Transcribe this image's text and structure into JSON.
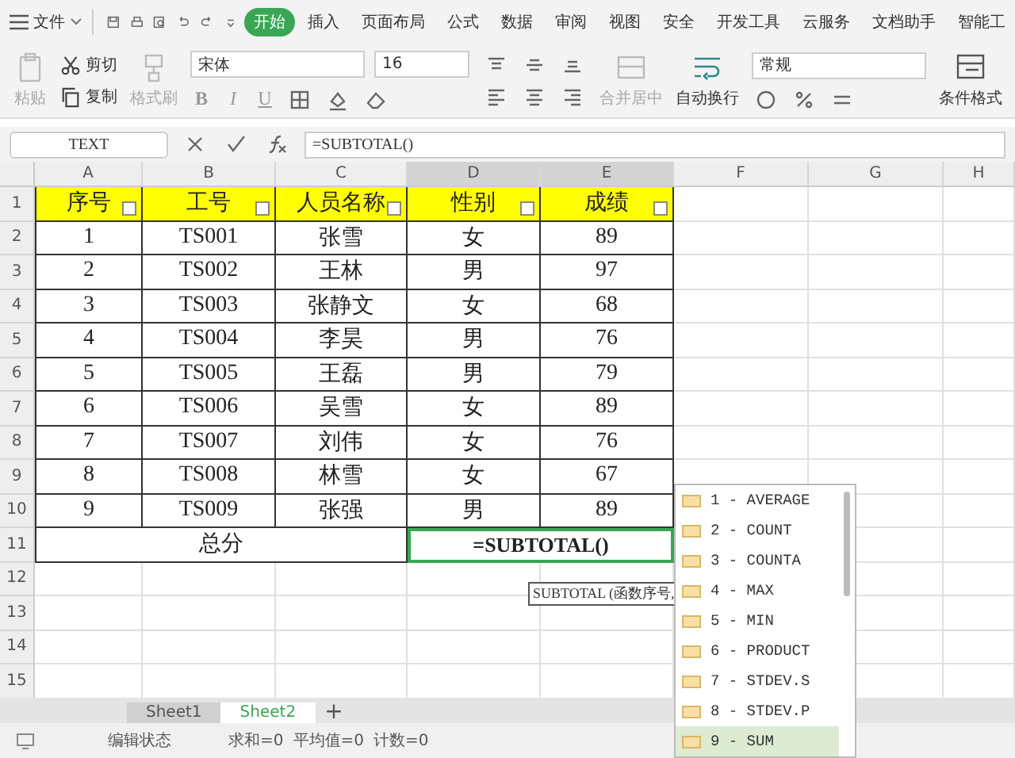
{
  "menu": {
    "file": "文件",
    "tabs": [
      {
        "label": "开始",
        "selected": true
      },
      {
        "label": "插入",
        "selected": false
      },
      {
        "label": "页面布局",
        "selected": false
      },
      {
        "label": "公式",
        "selected": false
      },
      {
        "label": "数据",
        "selected": false
      },
      {
        "label": "审阅",
        "selected": false
      },
      {
        "label": "视图",
        "selected": false
      },
      {
        "label": "安全",
        "selected": false
      },
      {
        "label": "开发工具",
        "selected": false
      },
      {
        "label": "云服务",
        "selected": false
      },
      {
        "label": "文档助手",
        "selected": false
      },
      {
        "label": "智能工",
        "selected": false
      }
    ]
  },
  "ribbon": {
    "paste": {
      "label": "粘贴",
      "disabled": true
    },
    "cut": "剪切",
    "copy": "复制",
    "format_painter": {
      "label": "格式刷",
      "disabled": true
    },
    "font": "宋体",
    "font_size": "16",
    "style_buttons": [
      "B",
      "I",
      "U"
    ],
    "merge": {
      "label": "合并居中",
      "disabled": true
    },
    "wrap": "自动换行",
    "number_format": "常规",
    "conditional_format": "条件格式"
  },
  "formula_bar": {
    "name_box": "TEXT",
    "formula": "=SUBTOTAL()"
  },
  "sheet": {
    "columns": [
      {
        "label": "A",
        "selected": false
      },
      {
        "label": "B",
        "selected": false
      },
      {
        "label": "C",
        "selected": false
      },
      {
        "label": "D",
        "selected": true
      },
      {
        "label": "E",
        "selected": true
      },
      {
        "label": "F",
        "selected": false
      },
      {
        "label": "G",
        "selected": false
      },
      {
        "label": "H",
        "selected": false
      }
    ],
    "row_headers": [
      "1",
      "2",
      "3",
      "4",
      "5",
      "6",
      "7",
      "8",
      "9",
      "10",
      "11",
      "12",
      "13",
      "14",
      "15"
    ],
    "header": [
      "序号",
      "工号",
      "人员名称",
      "性别",
      "成绩"
    ],
    "rows": [
      [
        "1",
        "TS001",
        "张雪",
        "女",
        "89"
      ],
      [
        "2",
        "TS002",
        "王林",
        "男",
        "97"
      ],
      [
        "3",
        "TS003",
        "张静文",
        "女",
        "68"
      ],
      [
        "4",
        "TS004",
        "李昊",
        "男",
        "76"
      ],
      [
        "5",
        "TS005",
        "王磊",
        "男",
        "79"
      ],
      [
        "6",
        "TS006",
        "吴雪",
        "女",
        "89"
      ],
      [
        "7",
        "TS007",
        "刘伟",
        "女",
        "76"
      ],
      [
        "8",
        "TS008",
        "林雪",
        "女",
        "67"
      ],
      [
        "9",
        "TS009",
        "张强",
        "男",
        "89"
      ]
    ],
    "total_row": {
      "label": "总分",
      "formula": "=SUBTOTAL()"
    }
  },
  "tooltip": "SUBTOTAL (函数序号,",
  "autocomplete": [
    {
      "label": "1 - AVERAGE",
      "selected": false
    },
    {
      "label": "2 - COUNT",
      "selected": false
    },
    {
      "label": "3 - COUNTA",
      "selected": false
    },
    {
      "label": "4 - MAX",
      "selected": false
    },
    {
      "label": "5 - MIN",
      "selected": false
    },
    {
      "label": "6 - PRODUCT",
      "selected": false
    },
    {
      "label": "7 - STDEV.S",
      "selected": false
    },
    {
      "label": "8 - STDEV.P",
      "selected": false
    },
    {
      "label": "9 - SUM",
      "selected": true
    }
  ],
  "sheet_tabs": [
    {
      "label": "Sheet1",
      "selected": false
    },
    {
      "label": "Sheet2",
      "selected": true
    }
  ],
  "add_sheet": "+",
  "status_bar": {
    "mode": "编辑状态",
    "sum": "求和=0",
    "average": "平均值=0",
    "count": "计数=0"
  }
}
